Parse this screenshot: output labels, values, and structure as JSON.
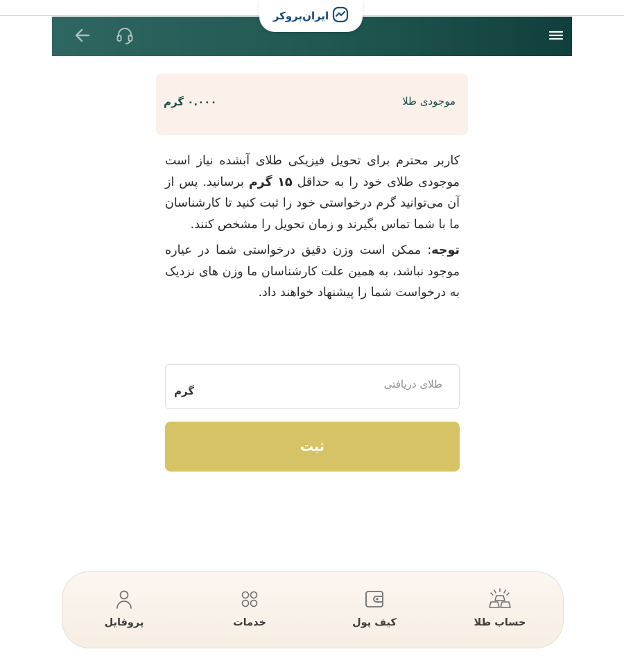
{
  "brand": {
    "name": "ایران‌بروکر"
  },
  "header": {
    "back_icon": "arrow-left-icon",
    "support_icon": "headset-icon",
    "menu_icon": "hamburger-menu-icon"
  },
  "balance": {
    "label": "موجودی طلا",
    "value": "۰.۰۰۰ گرم"
  },
  "info": {
    "p1_before": "کاربر محترم برای تحویل فیزیکی طلای آبشده نیاز است موجودی طلای خود را به حداقل ",
    "p1_bold": "۱۵ گرم",
    "p1_after": " برسانید. پس از آن می‌توانید گرم درخواستی خود را ثبت کنید تا کارشناسان ما با شما تماس بگیرند و زمان تحویل را مشخص کنند.",
    "note_label": "توجه",
    "note_text": ": ممکن است وزن دقیق درخواستی شما در عیاره موجود نباشد، به همین علت کارشناسان ما وزن های نزدیک به درخواست شما را پیشنهاد خواهند داد."
  },
  "form": {
    "placeholder": "طلای دریافتی",
    "unit": "گرم",
    "submit_label": "ثبت"
  },
  "nav": {
    "items": [
      {
        "label": "حساب طلا",
        "icon": "gold-bars-icon"
      },
      {
        "label": "کیف پول",
        "icon": "wallet-icon"
      },
      {
        "label": "خدمات",
        "icon": "grid-icon"
      },
      {
        "label": "پروفایل",
        "icon": "user-icon"
      }
    ]
  },
  "colors": {
    "header": "#205751",
    "accent": "#d6c366",
    "balance_bg": "#fbf1ea",
    "brand": "#164a79"
  }
}
